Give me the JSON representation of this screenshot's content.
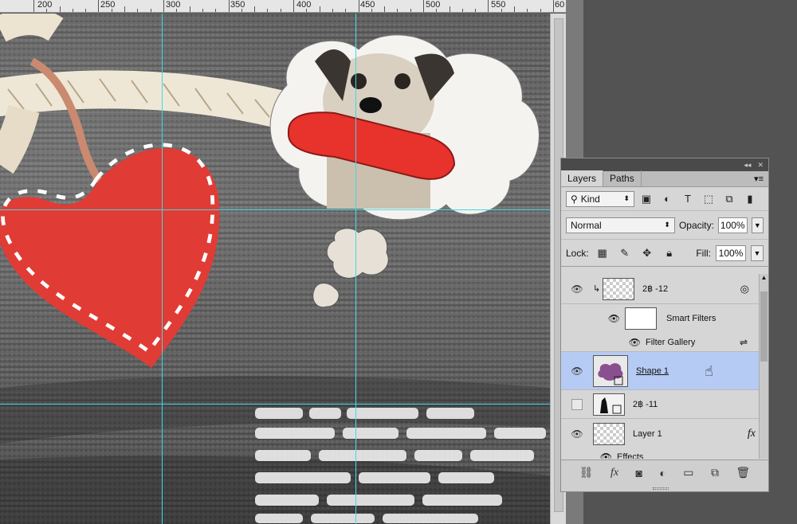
{
  "ruler": {
    "marks": [
      "200",
      "250",
      "300",
      "350",
      "400",
      "450",
      "500",
      "550",
      "60"
    ]
  },
  "layers_panel": {
    "tabs": [
      "Layers",
      "Paths"
    ],
    "kind_label": "Kind",
    "blend_mode": "Normal",
    "opacity_label": "Opacity:",
    "opacity_value": "100%",
    "lock_label": "Lock:",
    "fill_label": "Fill:",
    "fill_value": "100%",
    "layers": [
      {
        "name": "2฿ -12"
      },
      {
        "name": "Smart Filters"
      },
      {
        "name": "Filter Gallery"
      },
      {
        "name": "Shape 1"
      },
      {
        "name": "2฿ -11"
      },
      {
        "name": "Layer 1"
      },
      {
        "name": "Effects"
      }
    ]
  },
  "colors": {
    "guide": "#3fd9e6",
    "selected_layer": "#b6cbf4",
    "heart": "#e13b35"
  }
}
